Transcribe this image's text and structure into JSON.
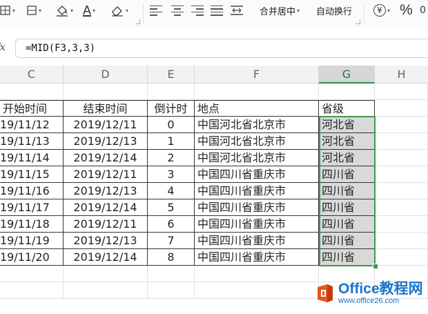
{
  "ribbon": {
    "merge_center_label": "合并居中",
    "auto_wrap_label": "自动换行",
    "percent_label": "%",
    "font_color_label": "A",
    "currency_label": "¥"
  },
  "formula_bar": {
    "fx_label": "fx",
    "formula": "=MID(F3,3,3)"
  },
  "columns": [
    "C",
    "D",
    "E",
    "F",
    "G",
    "H"
  ],
  "table": {
    "headers": [
      "开始时间",
      "结束时间",
      "倒计时",
      "地点",
      "省级"
    ],
    "rows": [
      [
        "19/11/12",
        "2019/12/11",
        "0",
        "中国河北省北京市",
        "河北省"
      ],
      [
        "19/11/13",
        "2019/12/13",
        "1",
        "中国河北省北京市",
        "河北省"
      ],
      [
        "19/11/14",
        "2019/12/14",
        "2",
        "中国河北省北京市",
        "河北省"
      ],
      [
        "19/11/15",
        "2019/12/11",
        "3",
        "中国四川省重庆市",
        "四川省"
      ],
      [
        "19/11/16",
        "2019/12/13",
        "4",
        "中国四川省重庆市",
        "四川省"
      ],
      [
        "19/11/17",
        "2019/12/14",
        "5",
        "中国四川省重庆市",
        "四川省"
      ],
      [
        "19/11/18",
        "2019/12/11",
        "6",
        "中国四川省重庆市",
        "四川省"
      ],
      [
        "19/11/19",
        "2019/12/13",
        "7",
        "中国四川省重庆市",
        "四川省"
      ],
      [
        "19/11/20",
        "2019/12/14",
        "8",
        "中国四川省重庆市",
        "四川省"
      ]
    ]
  },
  "watermark": {
    "title": "Office教程网",
    "url": "www.office26.com"
  },
  "colors": {
    "selection": "#3c9b4a",
    "watermark": "#1a73c9",
    "logo": "#e8541c"
  },
  "icons": [
    "border-icon",
    "fill-color-icon",
    "font-color-icon",
    "eraser-icon",
    "align-left-icon",
    "align-center-icon",
    "align-right-icon",
    "justify-icon",
    "distribute-icon",
    "currency-icon",
    "percent-icon",
    "office-logo-icon"
  ]
}
